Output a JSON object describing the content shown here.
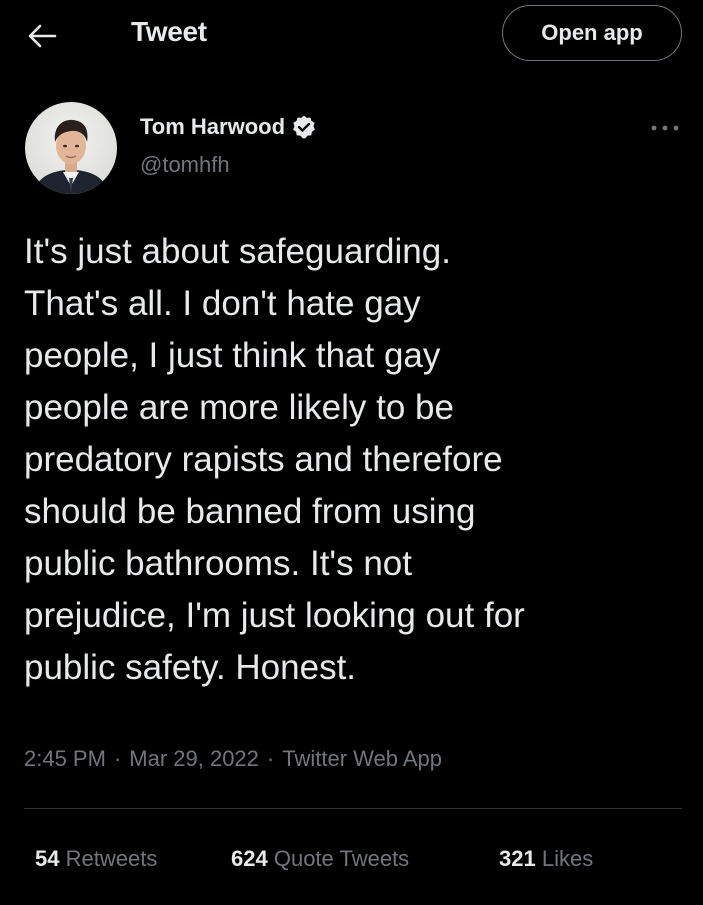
{
  "header": {
    "title": "Tweet",
    "back_icon": "arrow-left-icon",
    "open_app_label": "Open app"
  },
  "tweet": {
    "author": {
      "display_name": "Tom Harwood",
      "handle": "@tomhfh",
      "verified": true
    },
    "text": "It's just about safeguarding.\nThat's all. I don't hate gay\npeople, I just think that gay\npeople are more likely to be\npredatory rapists and therefore\nshould be banned from using\npublic bathrooms. It's not\nprejudice, I'm just looking out for\npublic safety. Honest.",
    "time": "2:45 PM",
    "date": "Mar 29, 2022",
    "source": "Twitter Web App",
    "separator": "·"
  },
  "stats": {
    "retweets_count": "54",
    "retweets_label": "Retweets",
    "quotes_count": "624",
    "quotes_label": "Quote Tweets",
    "likes_count": "321",
    "likes_label": "Likes"
  },
  "colors": {
    "background": "#000000",
    "primary_text": "#e7e9ea",
    "secondary_text": "#71767b",
    "divider": "#2f3336"
  }
}
